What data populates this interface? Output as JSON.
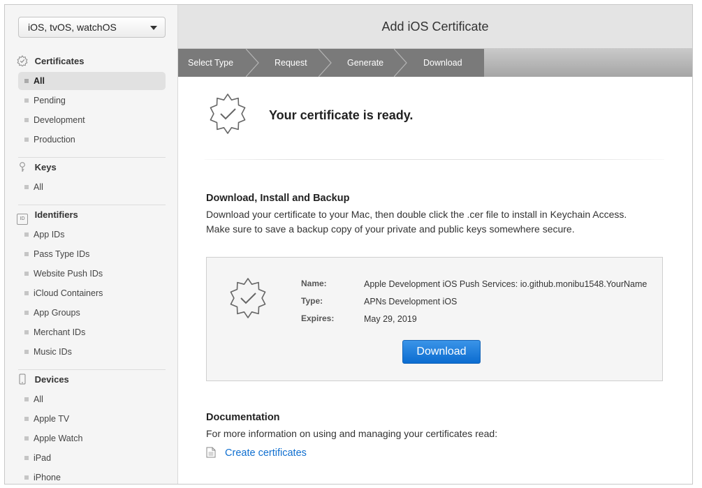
{
  "sidebar": {
    "platform": "iOS, tvOS, watchOS",
    "sections": {
      "certificates": {
        "title": "Certificates",
        "items": [
          "All",
          "Pending",
          "Development",
          "Production"
        ]
      },
      "keys": {
        "title": "Keys",
        "items": [
          "All"
        ]
      },
      "identifiers": {
        "title": "Identifiers",
        "items": [
          "App IDs",
          "Pass Type IDs",
          "Website Push IDs",
          "iCloud Containers",
          "App Groups",
          "Merchant IDs",
          "Music IDs"
        ]
      },
      "devices": {
        "title": "Devices",
        "items": [
          "All",
          "Apple TV",
          "Apple Watch",
          "iPad",
          "iPhone"
        ]
      }
    },
    "identifiers_icon_text": "ID"
  },
  "header": {
    "title": "Add iOS Certificate"
  },
  "steps": [
    "Select Type",
    "Request",
    "Generate",
    "Download"
  ],
  "main": {
    "ready_title": "Your certificate is ready.",
    "backup_title": "Download, Install and Backup",
    "backup_text": "Download your certificate to your Mac, then double click the .cer file to install in Keychain Access. Make sure to save a backup copy of your private and public keys somewhere secure.",
    "cert": {
      "name_label": "Name:",
      "name_value": "Apple Development iOS Push Services: io.github.monibu1548.YourName",
      "type_label": "Type:",
      "type_value": "APNs Development iOS",
      "expires_label": "Expires:",
      "expires_value": "May 29, 2019"
    },
    "download_label": "Download",
    "doc_title": "Documentation",
    "doc_text": "For more information on using and managing your certificates read:",
    "doc_link": "Create certificates"
  },
  "colors": {
    "accent_blue": "#0f6fd0",
    "button_blue": "#1a7de0",
    "step_done": "#7a7a7a"
  }
}
